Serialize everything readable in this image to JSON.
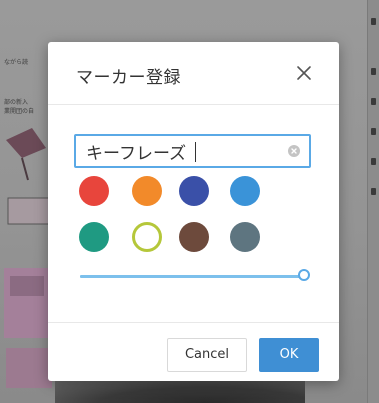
{
  "background": {
    "snippet_1": "ながら読",
    "snippet_2": "部の新入",
    "snippet_3": "業開団の自"
  },
  "dialog": {
    "title": "マーカー登録",
    "close_icon": "close-icon",
    "name_input": {
      "value": "キーフレーズ",
      "clear_icon": "clear-circle-icon"
    },
    "colors": [
      {
        "name": "red",
        "hex": "#e8453c",
        "selected": false
      },
      {
        "name": "orange",
        "hex": "#f28a2a",
        "selected": false
      },
      {
        "name": "indigo",
        "hex": "#3a50a8",
        "selected": false
      },
      {
        "name": "blue",
        "hex": "#3a93d8",
        "selected": false
      },
      {
        "name": "teal",
        "hex": "#1f9a82",
        "selected": false
      },
      {
        "name": "lime",
        "hex": "#b5c73a",
        "selected": true
      },
      {
        "name": "brown",
        "hex": "#6d4a3c",
        "selected": false
      },
      {
        "name": "blue-gray",
        "hex": "#5e7580",
        "selected": false
      }
    ],
    "opacity_slider": {
      "value": 1.0
    },
    "cancel_label": "Cancel",
    "ok_label": "OK"
  }
}
